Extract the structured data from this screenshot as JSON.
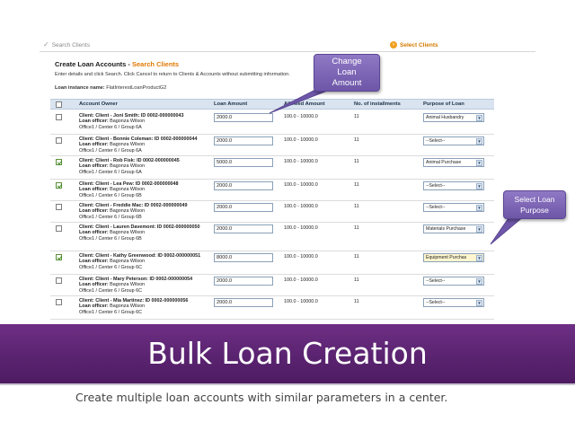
{
  "steps": {
    "step1_label": "Search Clients",
    "step2_label": "Select Clients"
  },
  "page": {
    "title": "Create Loan Accounts - ",
    "title_sub": "Search Clients",
    "instructions": "Enter details and click Search. Click Cancel to return to Clients & Accounts without submitting information.",
    "instance_label": "Loan instance name:",
    "instance_value": "FlatInterestLoanProductG2"
  },
  "table": {
    "headers": {
      "account_owner": "Account Owner",
      "loan_amount": "Loan Amount",
      "allowed_amount": "Allowed Amount",
      "installments": "No. of installments",
      "purpose": "Purpose of Loan"
    },
    "rows": [
      {
        "checked": false,
        "client": "Client: Client - Joni Smith: ID 0002-000000043",
        "officer_label": "Loan officer:",
        "officer": "Bagonza Wilson",
        "office": "Office1 / Center 6 / Group 6A",
        "amount": "2000.0",
        "allowed": "100.0  -  10000.0",
        "installments": "11",
        "purpose": "Animal Husbandry"
      },
      {
        "checked": false,
        "client": "Client: Client - Bonnie Coleman: ID 0002-000000044",
        "officer_label": "Loan officer:",
        "officer": "Bagonza Wilson",
        "office": "Office1 / Center 6 / Group 6A",
        "amount": "2000.0",
        "allowed": "100.0  -  10000.0",
        "installments": "11",
        "purpose": "--Select--"
      },
      {
        "checked": true,
        "client": "Client: Client - Rob Fisk: ID 0002-000000045",
        "officer_label": "Loan officer:",
        "officer": "Bagonza Wilson",
        "office": "Office1 / Center 6 / Group 6A",
        "amount": "5000.0",
        "allowed": "100.0  -  10000.0",
        "installments": "11",
        "purpose": "Animal Purchase"
      },
      {
        "checked": true,
        "client": "Client: Client - Lea Pew: ID 0002-000000048",
        "officer_label": "Loan officer:",
        "officer": "Bagonza Wilson",
        "office": "Office1 / Center 6 / Group 6B",
        "amount": "2000.0",
        "allowed": "100.0  -  10000.0",
        "installments": "11",
        "purpose": "--Select--"
      },
      {
        "checked": false,
        "client": "Client: Client - Freddie Mac: ID 0002-000000049",
        "officer_label": "Loan officer:",
        "officer": "Bagonza Wilson",
        "office": "Office1 / Center 6 / Group 6B",
        "amount": "2000.0",
        "allowed": "100.0  -  10000.0",
        "installments": "11",
        "purpose": "--Select--"
      },
      {
        "checked": false,
        "client": "Client: Client - Lauren Davemont: ID 0002-000000050",
        "officer_label": "Loan officer:",
        "officer": "Bagonza Wilson",
        "office": "Office1 / Center 6 / Group 6B",
        "amount": "2000.0",
        "allowed": "100.0  -  10000.0",
        "installments": "11",
        "purpose": "Materials Purchase"
      },
      {
        "checked": true,
        "client": "Client: Client - Kathy Greenwood: ID 0002-000000051",
        "officer_label": "Loan officer:",
        "officer": "Bagonza Wilson",
        "office": "Office1 / Center 6 / Group 6C",
        "amount": "8000.0",
        "allowed": "100.0  -  10000.0",
        "installments": "11",
        "purpose": "Equipment Purchas"
      },
      {
        "checked": false,
        "client": "Client: Client - Mary Peterson: ID 0002-000000054",
        "officer_label": "Loan officer:",
        "officer": "Bagonza Wilson",
        "office": "Office1 / Center 6 / Group 6C",
        "amount": "2000.0",
        "allowed": "100.0  -  10000.0",
        "installments": "11",
        "purpose": "--Select--"
      },
      {
        "checked": false,
        "client": "Client: Client - Mia Martinez: ID 0002-000000056",
        "officer_label": "Loan officer:",
        "officer": "Bagonza Wilson",
        "office": "Office1 / Center 6 / Group 6C",
        "amount": "2000.0",
        "allowed": "100.0  -  10000.0",
        "installments": "11",
        "purpose": "--Select--"
      }
    ]
  },
  "callouts": {
    "change_amount": [
      "Change",
      "Loan",
      "Amount"
    ],
    "select_purpose": [
      "Select Loan",
      "Purpose"
    ]
  },
  "banner": {
    "title": "Bulk Loan Creation",
    "subtitle": "Create multiple loan accounts with similar parameters in a center."
  },
  "colors": {
    "banner": "#5a2370",
    "callout": "#7a63b3",
    "accent_orange": "#e07800",
    "header_row": "#d9e4f0"
  }
}
